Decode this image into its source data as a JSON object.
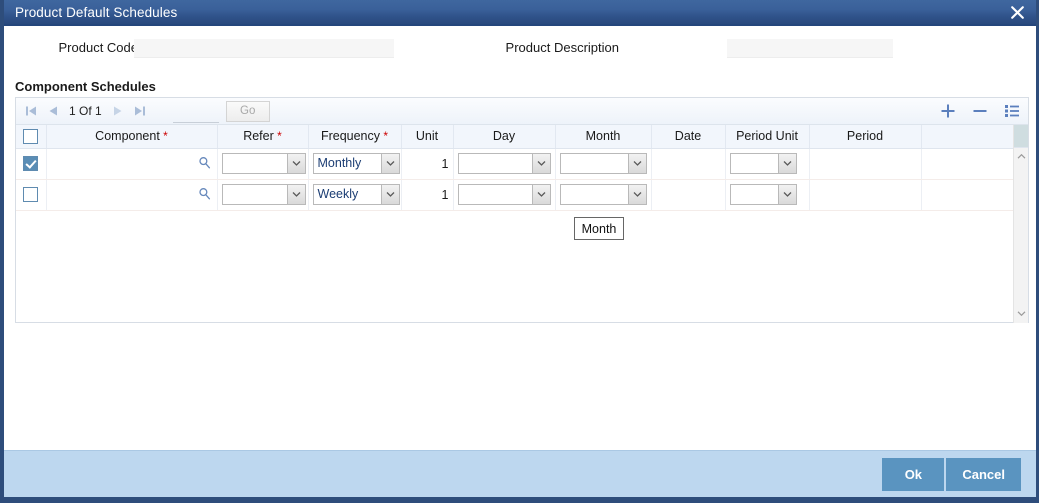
{
  "window": {
    "title": "Product Default Schedules",
    "close_icon": "close-icon"
  },
  "fields": {
    "product_code_label": "Product Code",
    "product_code_value": "",
    "product_code_placeholder": "",
    "product_description_label": "Product Description",
    "product_description_value": "",
    "product_description_placeholder": ""
  },
  "section": {
    "title": "Component Schedules"
  },
  "toolbar": {
    "first_icon": "first-page-icon",
    "prev_icon": "previous-page-icon",
    "page_text": "1 Of 1",
    "next_icon": "next-page-icon",
    "last_icon": "last-page-icon",
    "page_input_value": "",
    "go_label": "Go",
    "add_icon": "plus-icon",
    "delete_icon": "minus-icon",
    "options_icon": "list-options-icon"
  },
  "grid": {
    "columns": [
      {
        "label": "",
        "required": false
      },
      {
        "label": "Component",
        "required": true
      },
      {
        "label": "Refer",
        "required": true
      },
      {
        "label": "Frequency",
        "required": true
      },
      {
        "label": "Unit",
        "required": false
      },
      {
        "label": "Day",
        "required": false
      },
      {
        "label": "Month",
        "required": false
      },
      {
        "label": "Date",
        "required": false
      },
      {
        "label": "Period Unit",
        "required": false
      },
      {
        "label": "Period",
        "required": false
      },
      {
        "label": "",
        "required": false
      }
    ],
    "rows": [
      {
        "selected": true,
        "component": "",
        "refer": "",
        "frequency": "Monthly",
        "unit": "1",
        "day": "",
        "month": "",
        "date": "",
        "period_unit": "",
        "period": ""
      },
      {
        "selected": false,
        "component": "",
        "refer": "",
        "frequency": "Weekly",
        "unit": "1",
        "day": "",
        "month": "",
        "date": "",
        "period_unit": "",
        "period": ""
      }
    ],
    "scrollbar_up_icon": "scroll-up-icon",
    "scrollbar_down_icon": "scroll-down-icon"
  },
  "tooltip": {
    "label": "Month"
  },
  "footer": {
    "ok_label": "Ok",
    "cancel_label": "Cancel"
  },
  "colors": {
    "titlebar": "#2f5289",
    "footer": "#bdd7ef",
    "button": "#5a94c0",
    "required_asterisk": "#cc0000",
    "dropdown_text": "#1b3d73",
    "checkbox_checked": "#5a8db5"
  }
}
